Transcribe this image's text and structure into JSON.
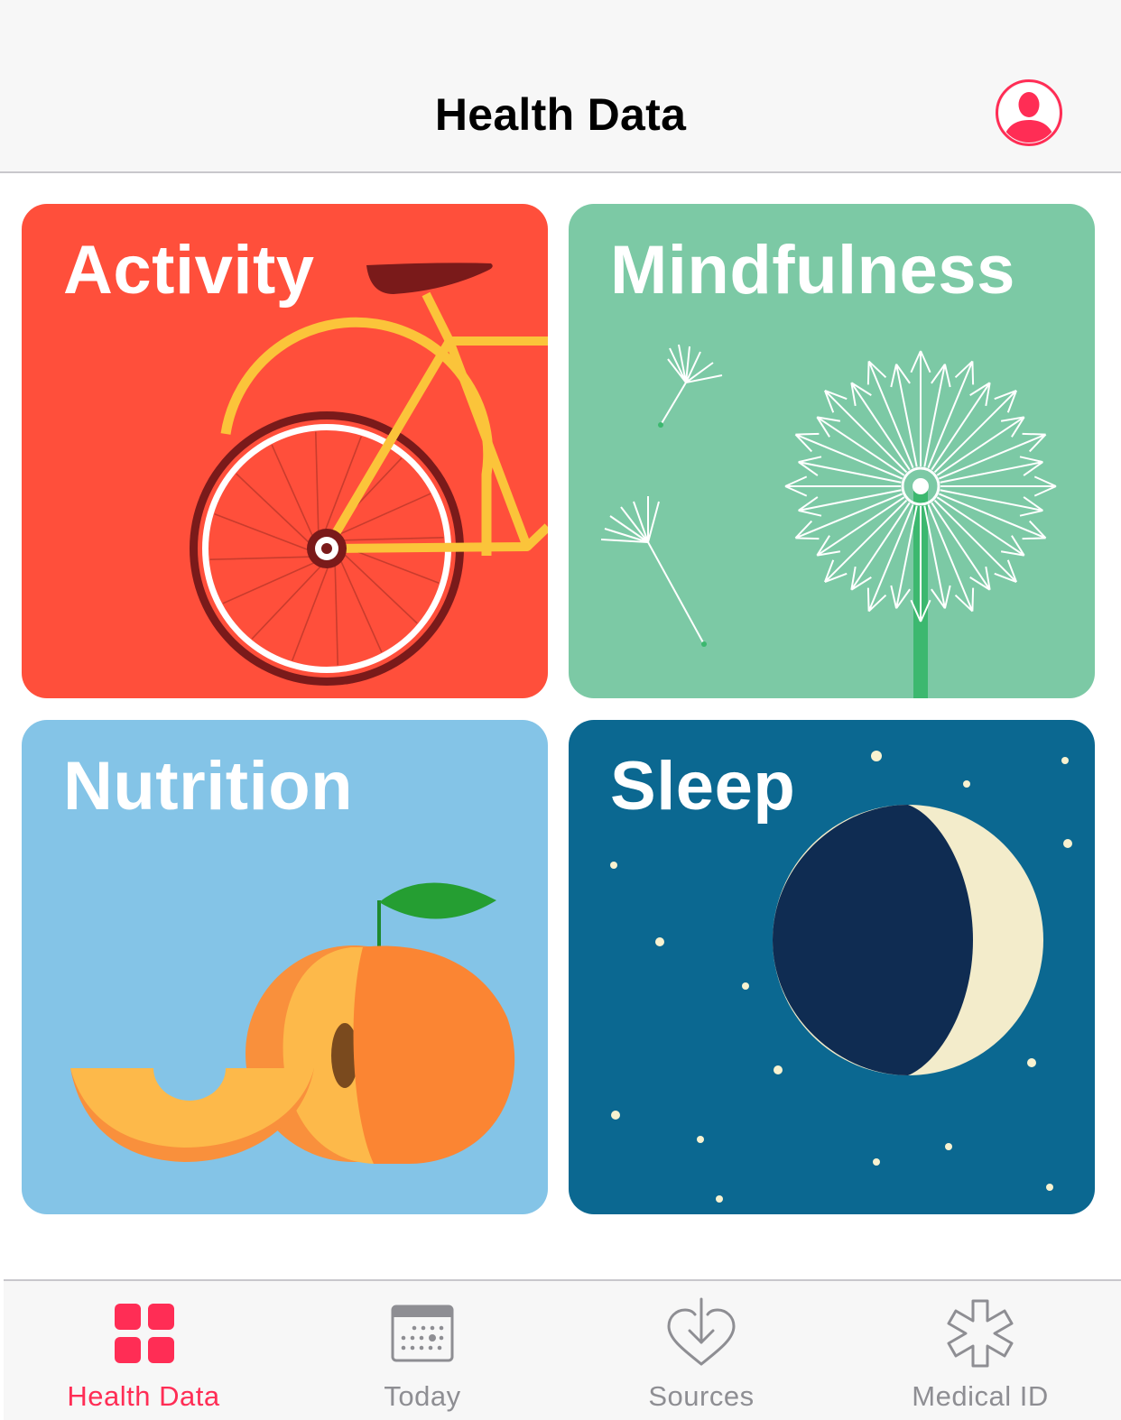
{
  "header": {
    "title": "Health Data"
  },
  "categories": [
    {
      "label": "Activity",
      "color": "#ff4f3b",
      "icon": "bicycle-illustration"
    },
    {
      "label": "Mindfulness",
      "color": "#7cc9a5",
      "icon": "dandelion-illustration"
    },
    {
      "label": "Nutrition",
      "color": "#84c4e7",
      "icon": "peach-illustration"
    },
    {
      "label": "Sleep",
      "color": "#0b6891",
      "icon": "moon-illustration"
    }
  ],
  "tabbar": {
    "active_color": "#ff2d55",
    "inactive_color": "#8e8e93",
    "tabs": [
      {
        "label": "Health Data",
        "icon": "grid-icon",
        "active": true
      },
      {
        "label": "Today",
        "icon": "calendar-icon",
        "active": false
      },
      {
        "label": "Sources",
        "icon": "heart-download-icon",
        "active": false
      },
      {
        "label": "Medical ID",
        "icon": "asterisk-icon",
        "active": false
      }
    ]
  }
}
